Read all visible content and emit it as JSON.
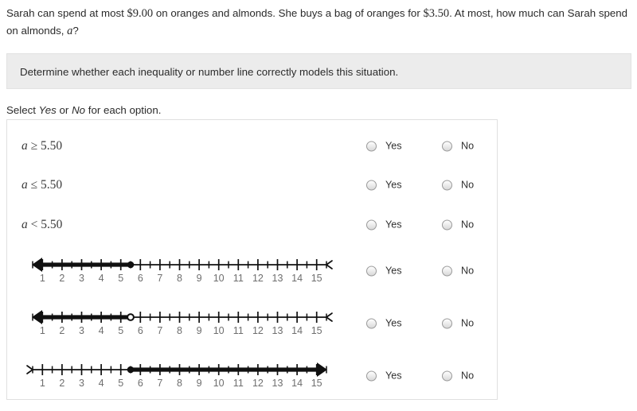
{
  "question": {
    "text_part1": "Sarah can spend at most ",
    "amount_total": "$9.00",
    "text_part2": " on oranges and almonds. She buys a bag of oranges for ",
    "amount_oranges": "$3.50",
    "text_part3": ". At most, how much can Sarah spend on almonds, ",
    "variable": "a",
    "text_part4": "?"
  },
  "directive": {
    "text": "Determine whether each inequality or number line correctly models this situation."
  },
  "select_prompt": {
    "prefix": "Select ",
    "yes": "Yes",
    "middle": " or ",
    "no": "No",
    "suffix": " for each option."
  },
  "choices": {
    "yes_label": "Yes",
    "no_label": "No"
  },
  "options": [
    {
      "kind": "inequality",
      "variable": "a",
      "operator": "≥",
      "value": "5.50",
      "yes_label": "Yes",
      "no_label": "No",
      "yes_selected": false,
      "no_selected": false
    },
    {
      "kind": "inequality",
      "variable": "a",
      "operator": "≤",
      "value": "5.50",
      "yes_label": "Yes",
      "no_label": "No",
      "yes_selected": false,
      "no_selected": false
    },
    {
      "kind": "inequality",
      "variable": "a",
      "operator": "<",
      "value": "5.50",
      "yes_label": "Yes",
      "no_label": "No",
      "yes_selected": false,
      "no_selected": false
    },
    {
      "kind": "numberline",
      "tick_labels": [
        "1",
        "2",
        "3",
        "4",
        "5",
        "6",
        "7",
        "8",
        "9",
        "10",
        "11",
        "12",
        "13",
        "14",
        "15"
      ],
      "axis_min": 0.5,
      "axis_max": 15.5,
      "endpoint_value": 5.5,
      "endpoint_style": "closed",
      "shading_direction": "left",
      "yes_label": "Yes",
      "no_label": "No",
      "yes_selected": false,
      "no_selected": false
    },
    {
      "kind": "numberline",
      "tick_labels": [
        "1",
        "2",
        "3",
        "4",
        "5",
        "6",
        "7",
        "8",
        "9",
        "10",
        "11",
        "12",
        "13",
        "14",
        "15"
      ],
      "axis_min": 0.5,
      "axis_max": 15.5,
      "endpoint_value": 5.5,
      "endpoint_style": "open",
      "shading_direction": "left",
      "yes_label": "Yes",
      "no_label": "No",
      "yes_selected": false,
      "no_selected": false
    },
    {
      "kind": "numberline",
      "tick_labels": [
        "1",
        "2",
        "3",
        "4",
        "5",
        "6",
        "7",
        "8",
        "9",
        "10",
        "11",
        "12",
        "13",
        "14",
        "15"
      ],
      "axis_min": 0.5,
      "axis_max": 15.5,
      "endpoint_value": 5.5,
      "endpoint_style": "closed",
      "shading_direction": "right",
      "yes_label": "Yes",
      "no_label": "No",
      "yes_selected": false,
      "no_selected": false
    }
  ],
  "colors": {
    "text": "#2b2b2b",
    "directive_background": "#ececec",
    "panel_border": "#e0e0e0",
    "tick_label": "#6e6e6e",
    "line_stroke": "#101010"
  }
}
